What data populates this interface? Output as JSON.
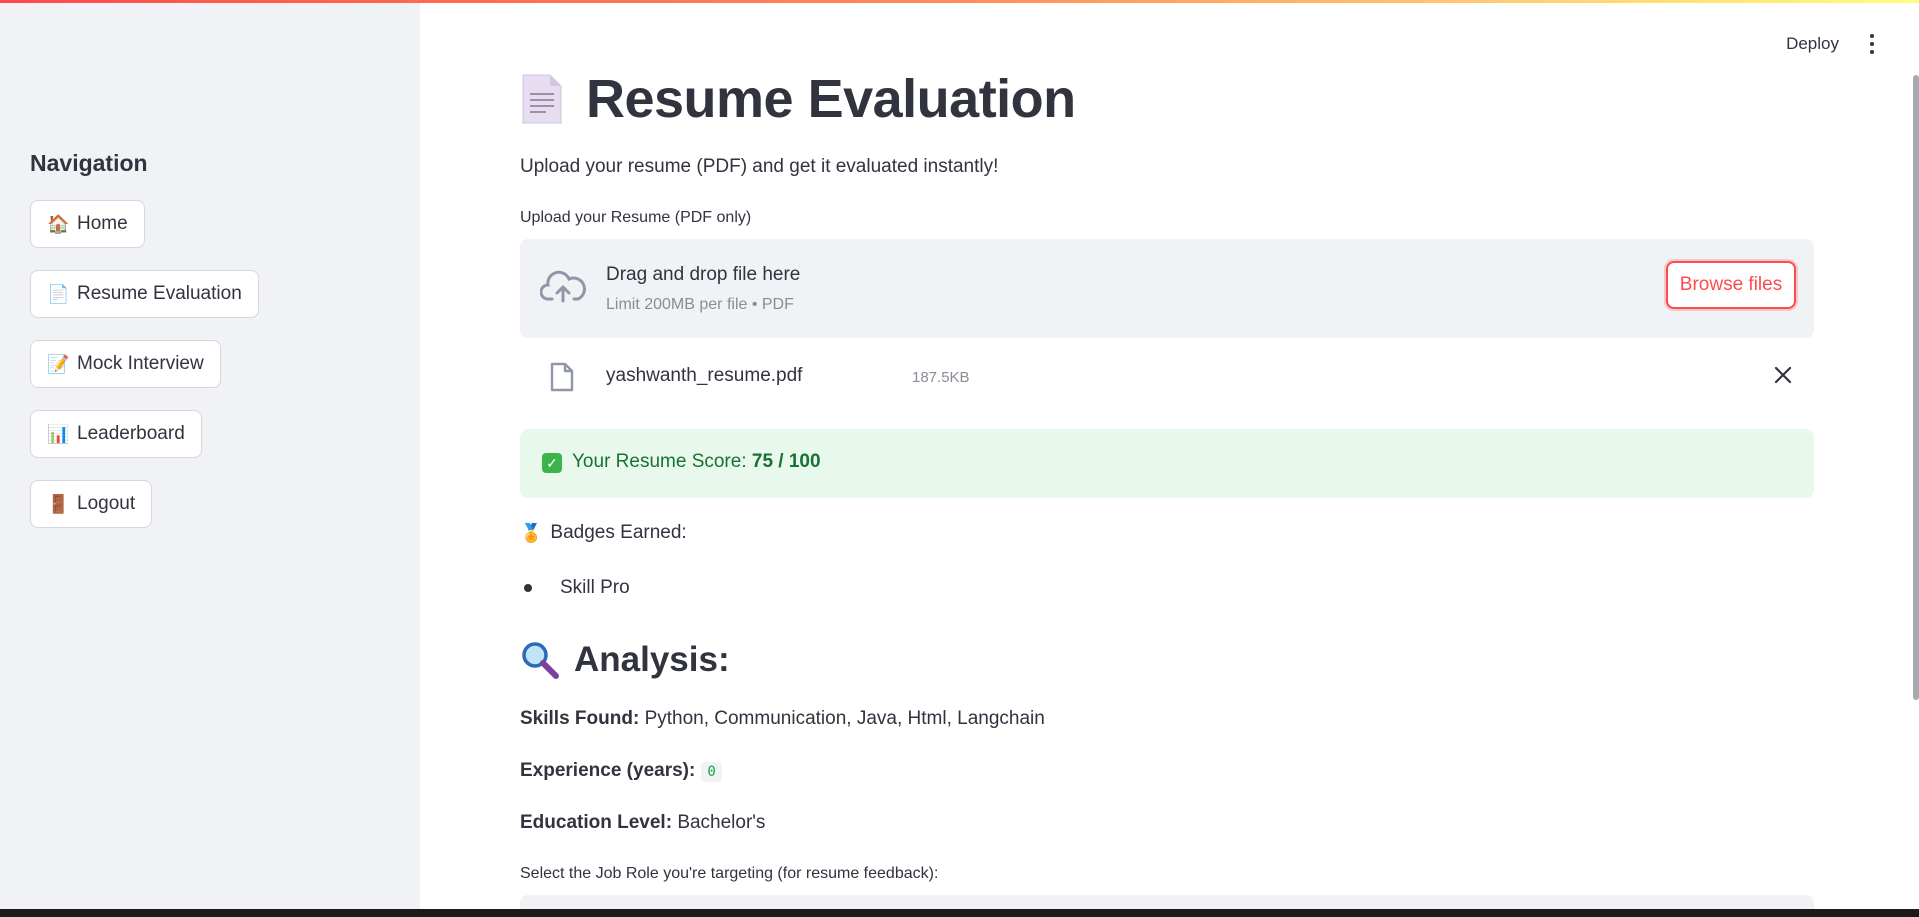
{
  "sidebar": {
    "title": "Navigation",
    "items": [
      {
        "emoji": "🏠",
        "label": "Home"
      },
      {
        "emoji": "📄",
        "label": "Resume Evaluation"
      },
      {
        "emoji": "📝",
        "label": "Mock Interview"
      },
      {
        "emoji": "📊",
        "label": "Leaderboard"
      },
      {
        "emoji": "🚪",
        "label": "Logout"
      }
    ]
  },
  "header": {
    "deploy_label": "Deploy"
  },
  "page": {
    "title": "Resume Evaluation",
    "subtitle": "Upload your resume (PDF) and get it evaluated instantly!"
  },
  "uploader": {
    "label": "Upload your Resume (PDF only)",
    "drop_text": "Drag and drop file here",
    "limit_text": "Limit 200MB per file • PDF",
    "browse_label": "Browse files"
  },
  "uploaded_file": {
    "name": "yashwanth_resume.pdf",
    "size": "187.5KB"
  },
  "score": {
    "prefix": "Your Resume Score: ",
    "value": "75 / 100"
  },
  "badges": {
    "label": "Badges Earned:",
    "items": [
      "Skill Pro"
    ]
  },
  "analysis": {
    "title": "Analysis:",
    "skills_label": "Skills Found:",
    "skills_value": "Python, Communication, Java, Html, Langchain",
    "experience_label": "Experience (years):",
    "experience_value": "0",
    "education_label": "Education Level:",
    "education_value": "Bachelor's"
  },
  "job_role": {
    "label": "Select the Job Role you're targeting (for resume feedback):"
  },
  "colors": {
    "accent": "#ff4b4b",
    "success_bg": "#e8f8ec",
    "success_text": "#177233",
    "sidebar_bg": "#f0f2f6"
  }
}
